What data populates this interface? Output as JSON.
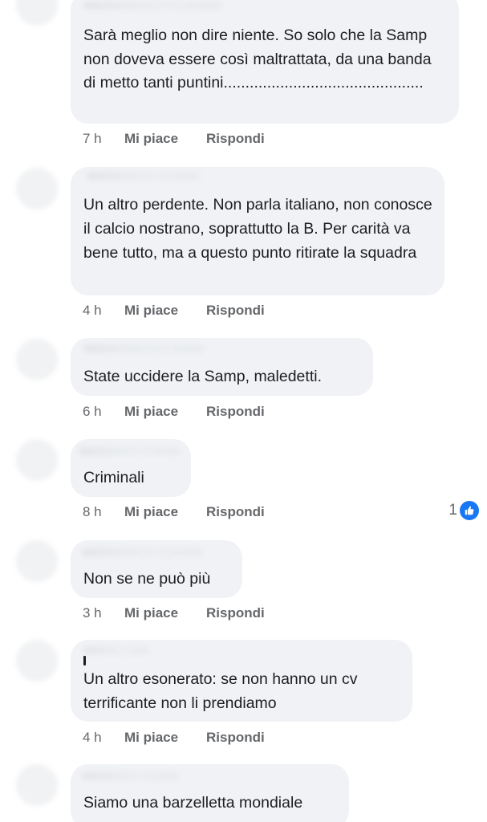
{
  "comments": [
    {
      "text": "Sarà meglio non dire niente. So solo che la Samp non doveva essere così maltrattata, da una banda di metto tanti puntini..............................................",
      "time": "7 h",
      "like_label": "Mi piace",
      "reply_label": "Rispondi"
    },
    {
      "text": "Un altro perdente. Non parla italiano, non conosce il calcio nostrano, soprattutto la B. Per carità va bene tutto, ma a questo punto ritirate la squadra",
      "time": "4 h",
      "like_label": "Mi piace",
      "reply_label": "Rispondi"
    },
    {
      "text": "State uccidere la Samp, maledetti.",
      "time": "6 h",
      "like_label": "Mi piace",
      "reply_label": "Rispondi"
    },
    {
      "text": "Criminali",
      "time": "8 h",
      "like_label": "Mi piace",
      "reply_label": "Rispondi",
      "reaction_count": "1",
      "reaction_icon": "like-icon"
    },
    {
      "text": "Non se ne può più",
      "time": "3 h",
      "like_label": "Mi piace",
      "reply_label": "Rispondi"
    },
    {
      "text": "Un altro esonerato: se non hanno un cv terrificante non li prendiamo",
      "time": "4 h",
      "like_label": "Mi piace",
      "reply_label": "Rispondi"
    },
    {
      "text": "Siamo una barzelletta mondiale"
    }
  ],
  "colors": {
    "bubble": "#f0f2f5",
    "meta_text": "#65676b",
    "like_badge": "#1877f2"
  }
}
